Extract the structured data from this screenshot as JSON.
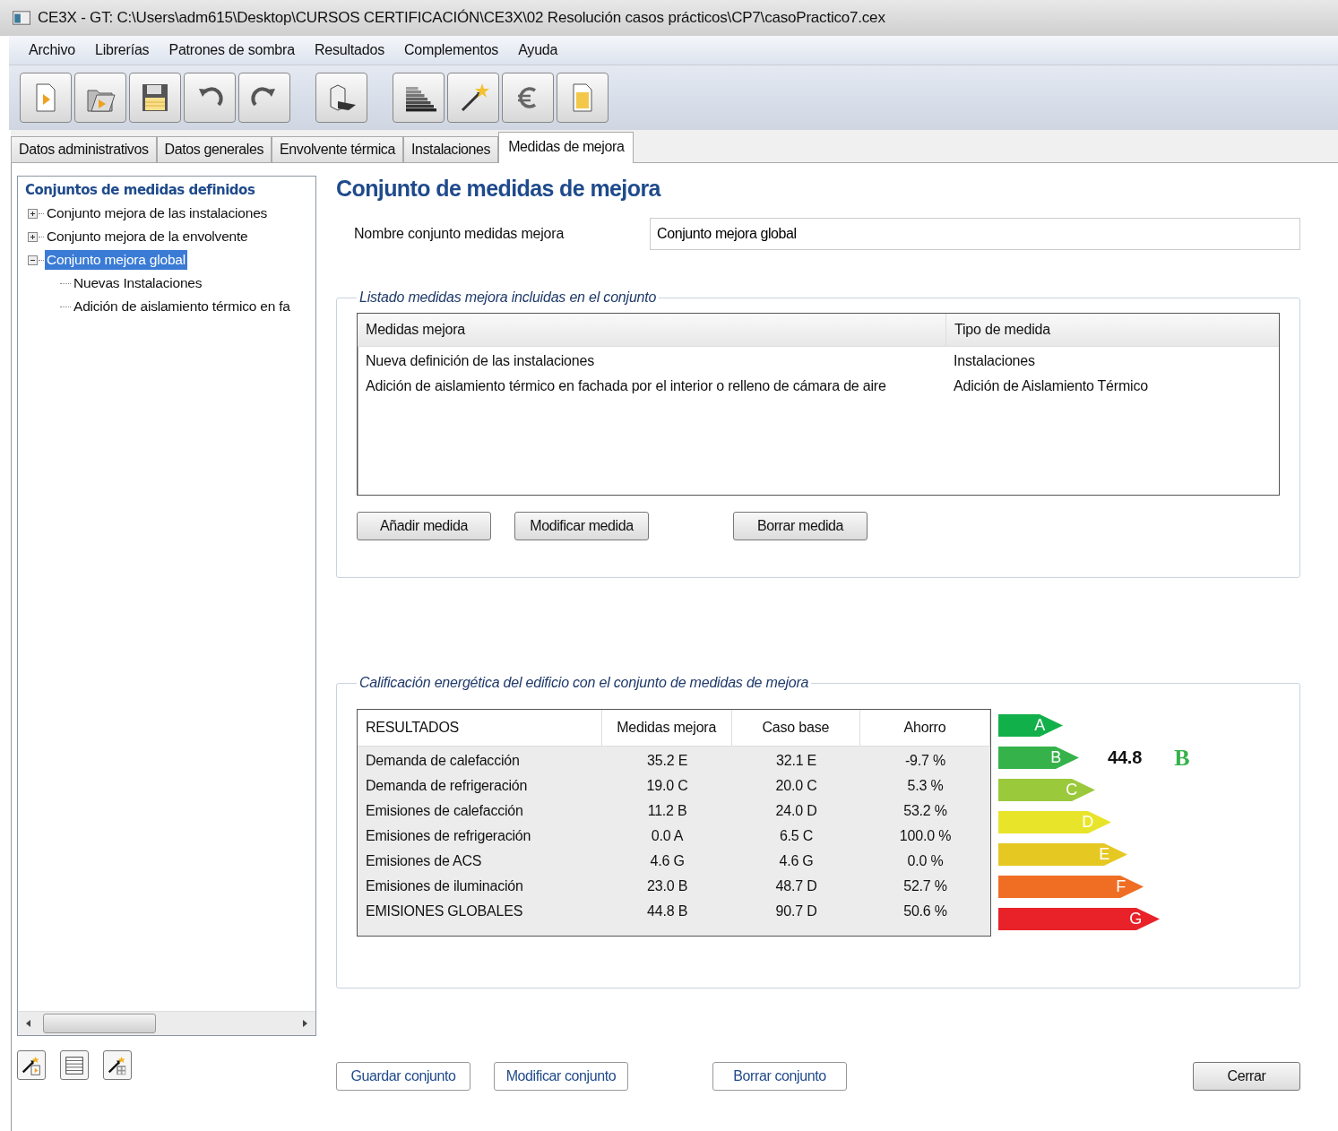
{
  "window": {
    "title": "CE3X - GT: C:\\Users\\adm615\\Desktop\\CURSOS CERTIFICACIÓN\\CE3X\\02 Resolución casos prácticos\\CP7\\casoPractico7.cex"
  },
  "menu": [
    "Archivo",
    "Librerías",
    "Patrones de sombra",
    "Resultados",
    "Complementos",
    "Ayuda"
  ],
  "toolbar": [
    {
      "kind": "new"
    },
    {
      "kind": "open"
    },
    {
      "kind": "save"
    },
    {
      "kind": "undo"
    },
    {
      "kind": "redo"
    },
    {
      "kind": "gap"
    },
    {
      "kind": "building"
    },
    {
      "kind": "gap"
    },
    {
      "kind": "rating"
    },
    {
      "kind": "wand"
    },
    {
      "kind": "euro"
    },
    {
      "kind": "report"
    }
  ],
  "tabs": [
    {
      "label": "Datos administrativos",
      "selected": false
    },
    {
      "label": "Datos generales",
      "selected": false
    },
    {
      "label": "Envolvente térmica",
      "selected": false
    },
    {
      "label": "Instalaciones",
      "selected": false
    },
    {
      "label": "Medidas de mejora",
      "selected": true
    }
  ],
  "sidebar": {
    "title": "Conjuntos de medidas definidos",
    "tree": [
      {
        "label": "Conjunto mejora de las instalaciones",
        "expanded": false,
        "selected": false
      },
      {
        "label": "Conjunto mejora de la envolvente",
        "expanded": false,
        "selected": false
      },
      {
        "label": "Conjunto mejora global",
        "expanded": true,
        "selected": true,
        "children": [
          {
            "label": "Nuevas Instalaciones",
            "selected": false
          },
          {
            "label": "Adición de aislamiento térmico en fa",
            "selected": false
          }
        ]
      }
    ],
    "tools": [
      {
        "kind": "wand-doc"
      },
      {
        "kind": "table"
      },
      {
        "kind": "wand-building"
      }
    ]
  },
  "heading": "Conjunto de medidas de mejora",
  "name_field": {
    "label": "Nombre conjunto medidas mejora",
    "value": "Conjunto mejora global"
  },
  "measures": {
    "legend": "Listado medidas mejora incluidas en el conjunto",
    "columns": [
      "Medidas mejora",
      "Tipo de medida"
    ],
    "rows": [
      [
        "Nueva definición de las instalaciones",
        "Instalaciones"
      ],
      [
        "Adición de aislamiento térmico en fachada por el interior o relleno de cámara de aire",
        "Adición de Aislamiento Térmico"
      ]
    ],
    "buttons": [
      "Añadir medida",
      "Modificar medida",
      "Borrar medida"
    ]
  },
  "rating": {
    "legend": "Calificación energética del edificio con el conjunto de medidas de mejora",
    "columns": [
      "RESULTADOS",
      "Medidas mejora",
      "Caso base",
      "Ahorro"
    ],
    "rows": [
      [
        "Demanda de calefacción",
        "35.2 E",
        "32.1 E",
        "-9.7 %"
      ],
      [
        "Demanda de refrigeración",
        "19.0 C",
        "20.0 C",
        "5.3 %"
      ],
      [
        "Emisiones de calefacción",
        "11.2 B",
        "24.0 D",
        "53.2 %"
      ],
      [
        "Emisiones de refrigeración",
        "0.0 A",
        "6.5 C",
        "100.0 %"
      ],
      [
        "Emisiones de ACS",
        "4.6 G",
        "4.6 G",
        "0.0 %"
      ],
      [
        "Emisiones de iluminación",
        "23.0 B",
        "48.7 D",
        "52.7 %"
      ],
      [
        "EMISIONES GLOBALES",
        "44.8 B",
        "90.7 D",
        "50.6 %"
      ]
    ],
    "scale": [
      {
        "letter": "A",
        "color": "#12b04a",
        "selected": false
      },
      {
        "letter": "B",
        "color": "#36b24a",
        "selected": true
      },
      {
        "letter": "C",
        "color": "#9bc93c",
        "selected": false
      },
      {
        "letter": "D",
        "color": "#e8e42a",
        "selected": false
      },
      {
        "letter": "E",
        "color": "#e6c822",
        "selected": false
      },
      {
        "letter": "F",
        "color": "#ef6e24",
        "selected": false
      },
      {
        "letter": "G",
        "color": "#e82228",
        "selected": false
      }
    ],
    "value": "44.8",
    "grade": "B"
  },
  "buttons": [
    "Guardar conjunto",
    "Modificar conjunto",
    "Borrar conjunto"
  ],
  "close_button": "Cerrar"
}
